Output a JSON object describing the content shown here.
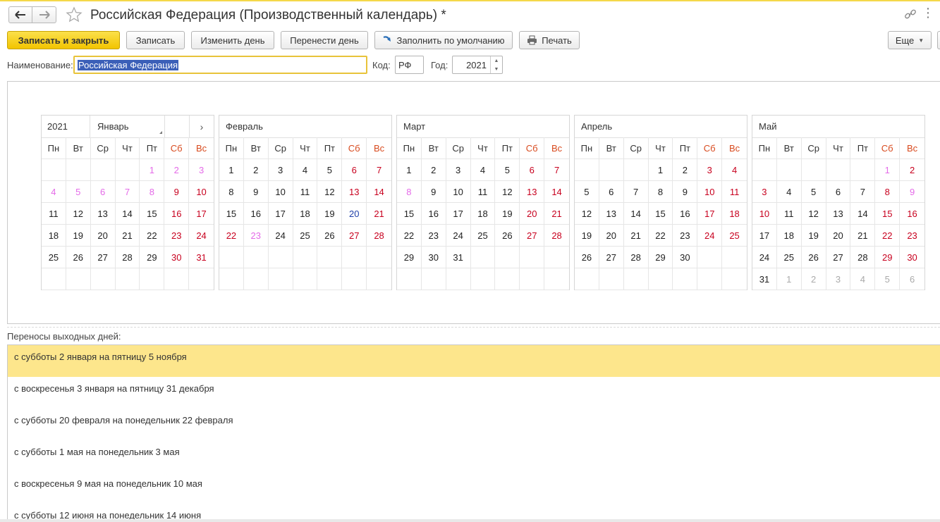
{
  "window": {
    "title": "Российская Федерация (Производственный календарь) *"
  },
  "toolbar": {
    "save_close": "Записать и закрыть",
    "save": "Записать",
    "change_day": "Изменить день",
    "move_day": "Перенести день",
    "fill_default": "Заполнить по умолчанию",
    "print": "Печать",
    "more": "Еще"
  },
  "form": {
    "name_label": "Наименование:",
    "name_value": "Российская Федерация",
    "code_label": "Код:",
    "code_value": "РФ",
    "year_label": "Год:",
    "year_value": "2021"
  },
  "calendar": {
    "year": "2021",
    "weekdays": [
      "Пн",
      "Вт",
      "Ср",
      "Чт",
      "Пт",
      "Сб",
      "Вс"
    ],
    "legend_colors": {
      "workday": "#222222",
      "holiday": "#c8001e",
      "pre_holiday": "#e46ae8",
      "transferred_workday": "#1f3fa8",
      "other_month": "#aaaaaa"
    },
    "months": [
      {
        "name": "Январь",
        "cells": [
          {
            "d": "",
            "t": "w"
          },
          {
            "d": "",
            "t": "w"
          },
          {
            "d": "",
            "t": "w"
          },
          {
            "d": "",
            "t": "w"
          },
          {
            "d": "1",
            "t": "p"
          },
          {
            "d": "2",
            "t": "p"
          },
          {
            "d": "3",
            "t": "p"
          },
          {
            "d": "4",
            "t": "p"
          },
          {
            "d": "5",
            "t": "p"
          },
          {
            "d": "6",
            "t": "p"
          },
          {
            "d": "7",
            "t": "p"
          },
          {
            "d": "8",
            "t": "p"
          },
          {
            "d": "9",
            "t": "h"
          },
          {
            "d": "10",
            "t": "h"
          },
          {
            "d": "11",
            "t": "w"
          },
          {
            "d": "12",
            "t": "w"
          },
          {
            "d": "13",
            "t": "w"
          },
          {
            "d": "14",
            "t": "w"
          },
          {
            "d": "15",
            "t": "w"
          },
          {
            "d": "16",
            "t": "h"
          },
          {
            "d": "17",
            "t": "h"
          },
          {
            "d": "18",
            "t": "w"
          },
          {
            "d": "19",
            "t": "w"
          },
          {
            "d": "20",
            "t": "w"
          },
          {
            "d": "21",
            "t": "w"
          },
          {
            "d": "22",
            "t": "w"
          },
          {
            "d": "23",
            "t": "h"
          },
          {
            "d": "24",
            "t": "h"
          },
          {
            "d": "25",
            "t": "w"
          },
          {
            "d": "26",
            "t": "w"
          },
          {
            "d": "27",
            "t": "w"
          },
          {
            "d": "28",
            "t": "w"
          },
          {
            "d": "29",
            "t": "w"
          },
          {
            "d": "30",
            "t": "h"
          },
          {
            "d": "31",
            "t": "h"
          },
          {
            "d": "",
            "t": "w"
          },
          {
            "d": "",
            "t": "w"
          },
          {
            "d": "",
            "t": "w"
          },
          {
            "d": "",
            "t": "w"
          },
          {
            "d": "",
            "t": "w"
          },
          {
            "d": "",
            "t": "w"
          },
          {
            "d": "",
            "t": "w"
          }
        ]
      },
      {
        "name": "Февраль",
        "cells": [
          {
            "d": "1",
            "t": "w"
          },
          {
            "d": "2",
            "t": "w"
          },
          {
            "d": "3",
            "t": "w"
          },
          {
            "d": "4",
            "t": "w"
          },
          {
            "d": "5",
            "t": "w"
          },
          {
            "d": "6",
            "t": "h"
          },
          {
            "d": "7",
            "t": "h"
          },
          {
            "d": "8",
            "t": "w"
          },
          {
            "d": "9",
            "t": "w"
          },
          {
            "d": "10",
            "t": "w"
          },
          {
            "d": "11",
            "t": "w"
          },
          {
            "d": "12",
            "t": "w"
          },
          {
            "d": "13",
            "t": "h"
          },
          {
            "d": "14",
            "t": "h"
          },
          {
            "d": "15",
            "t": "w"
          },
          {
            "d": "16",
            "t": "w"
          },
          {
            "d": "17",
            "t": "w"
          },
          {
            "d": "18",
            "t": "w"
          },
          {
            "d": "19",
            "t": "w"
          },
          {
            "d": "20",
            "t": "b"
          },
          {
            "d": "21",
            "t": "h"
          },
          {
            "d": "22",
            "t": "h"
          },
          {
            "d": "23",
            "t": "p"
          },
          {
            "d": "24",
            "t": "w"
          },
          {
            "d": "25",
            "t": "w"
          },
          {
            "d": "26",
            "t": "w"
          },
          {
            "d": "27",
            "t": "h"
          },
          {
            "d": "28",
            "t": "h"
          },
          {
            "d": "",
            "t": "w"
          },
          {
            "d": "",
            "t": "w"
          },
          {
            "d": "",
            "t": "w"
          },
          {
            "d": "",
            "t": "w"
          },
          {
            "d": "",
            "t": "w"
          },
          {
            "d": "",
            "t": "w"
          },
          {
            "d": "",
            "t": "w"
          },
          {
            "d": "",
            "t": "w"
          },
          {
            "d": "",
            "t": "w"
          },
          {
            "d": "",
            "t": "w"
          },
          {
            "d": "",
            "t": "w"
          },
          {
            "d": "",
            "t": "w"
          },
          {
            "d": "",
            "t": "w"
          },
          {
            "d": "",
            "t": "w"
          }
        ]
      },
      {
        "name": "Март",
        "cells": [
          {
            "d": "1",
            "t": "w"
          },
          {
            "d": "2",
            "t": "w"
          },
          {
            "d": "3",
            "t": "w"
          },
          {
            "d": "4",
            "t": "w"
          },
          {
            "d": "5",
            "t": "w"
          },
          {
            "d": "6",
            "t": "h"
          },
          {
            "d": "7",
            "t": "h"
          },
          {
            "d": "8",
            "t": "p"
          },
          {
            "d": "9",
            "t": "w"
          },
          {
            "d": "10",
            "t": "w"
          },
          {
            "d": "11",
            "t": "w"
          },
          {
            "d": "12",
            "t": "w"
          },
          {
            "d": "13",
            "t": "h"
          },
          {
            "d": "14",
            "t": "h"
          },
          {
            "d": "15",
            "t": "w"
          },
          {
            "d": "16",
            "t": "w"
          },
          {
            "d": "17",
            "t": "w"
          },
          {
            "d": "18",
            "t": "w"
          },
          {
            "d": "19",
            "t": "w"
          },
          {
            "d": "20",
            "t": "h"
          },
          {
            "d": "21",
            "t": "h"
          },
          {
            "d": "22",
            "t": "w"
          },
          {
            "d": "23",
            "t": "w"
          },
          {
            "d": "24",
            "t": "w"
          },
          {
            "d": "25",
            "t": "w"
          },
          {
            "d": "26",
            "t": "w"
          },
          {
            "d": "27",
            "t": "h"
          },
          {
            "d": "28",
            "t": "h"
          },
          {
            "d": "29",
            "t": "w"
          },
          {
            "d": "30",
            "t": "w"
          },
          {
            "d": "31",
            "t": "w"
          },
          {
            "d": "",
            "t": "w"
          },
          {
            "d": "",
            "t": "w"
          },
          {
            "d": "",
            "t": "w"
          },
          {
            "d": "",
            "t": "w"
          },
          {
            "d": "",
            "t": "w"
          },
          {
            "d": "",
            "t": "w"
          },
          {
            "d": "",
            "t": "w"
          },
          {
            "d": "",
            "t": "w"
          },
          {
            "d": "",
            "t": "w"
          },
          {
            "d": "",
            "t": "w"
          },
          {
            "d": "",
            "t": "w"
          }
        ]
      },
      {
        "name": "Апрель",
        "cells": [
          {
            "d": "",
            "t": "w"
          },
          {
            "d": "",
            "t": "w"
          },
          {
            "d": "",
            "t": "w"
          },
          {
            "d": "1",
            "t": "w"
          },
          {
            "d": "2",
            "t": "w"
          },
          {
            "d": "3",
            "t": "h"
          },
          {
            "d": "4",
            "t": "h"
          },
          {
            "d": "5",
            "t": "w"
          },
          {
            "d": "6",
            "t": "w"
          },
          {
            "d": "7",
            "t": "w"
          },
          {
            "d": "8",
            "t": "w"
          },
          {
            "d": "9",
            "t": "w"
          },
          {
            "d": "10",
            "t": "h"
          },
          {
            "d": "11",
            "t": "h"
          },
          {
            "d": "12",
            "t": "w"
          },
          {
            "d": "13",
            "t": "w"
          },
          {
            "d": "14",
            "t": "w"
          },
          {
            "d": "15",
            "t": "w"
          },
          {
            "d": "16",
            "t": "w"
          },
          {
            "d": "17",
            "t": "h"
          },
          {
            "d": "18",
            "t": "h"
          },
          {
            "d": "19",
            "t": "w"
          },
          {
            "d": "20",
            "t": "w"
          },
          {
            "d": "21",
            "t": "w"
          },
          {
            "d": "22",
            "t": "w"
          },
          {
            "d": "23",
            "t": "w"
          },
          {
            "d": "24",
            "t": "h"
          },
          {
            "d": "25",
            "t": "h"
          },
          {
            "d": "26",
            "t": "w"
          },
          {
            "d": "27",
            "t": "w"
          },
          {
            "d": "28",
            "t": "w"
          },
          {
            "d": "29",
            "t": "w"
          },
          {
            "d": "30",
            "t": "w"
          },
          {
            "d": "",
            "t": "w"
          },
          {
            "d": "",
            "t": "w"
          },
          {
            "d": "",
            "t": "w"
          },
          {
            "d": "",
            "t": "w"
          },
          {
            "d": "",
            "t": "w"
          },
          {
            "d": "",
            "t": "w"
          },
          {
            "d": "",
            "t": "w"
          },
          {
            "d": "",
            "t": "w"
          },
          {
            "d": "",
            "t": "w"
          }
        ]
      },
      {
        "name": "Май",
        "cells": [
          {
            "d": "",
            "t": "w"
          },
          {
            "d": "",
            "t": "w"
          },
          {
            "d": "",
            "t": "w"
          },
          {
            "d": "",
            "t": "w"
          },
          {
            "d": "",
            "t": "w"
          },
          {
            "d": "1",
            "t": "p"
          },
          {
            "d": "2",
            "t": "h"
          },
          {
            "d": "3",
            "t": "h"
          },
          {
            "d": "4",
            "t": "w"
          },
          {
            "d": "5",
            "t": "w"
          },
          {
            "d": "6",
            "t": "w"
          },
          {
            "d": "7",
            "t": "w"
          },
          {
            "d": "8",
            "t": "h"
          },
          {
            "d": "9",
            "t": "p"
          },
          {
            "d": "10",
            "t": "h"
          },
          {
            "d": "11",
            "t": "w"
          },
          {
            "d": "12",
            "t": "w"
          },
          {
            "d": "13",
            "t": "w"
          },
          {
            "d": "14",
            "t": "w"
          },
          {
            "d": "15",
            "t": "h"
          },
          {
            "d": "16",
            "t": "h"
          },
          {
            "d": "17",
            "t": "w"
          },
          {
            "d": "18",
            "t": "w"
          },
          {
            "d": "19",
            "t": "w"
          },
          {
            "d": "20",
            "t": "w"
          },
          {
            "d": "21",
            "t": "w"
          },
          {
            "d": "22",
            "t": "h"
          },
          {
            "d": "23",
            "t": "h"
          },
          {
            "d": "24",
            "t": "w"
          },
          {
            "d": "25",
            "t": "w"
          },
          {
            "d": "26",
            "t": "w"
          },
          {
            "d": "27",
            "t": "w"
          },
          {
            "d": "28",
            "t": "w"
          },
          {
            "d": "29",
            "t": "h"
          },
          {
            "d": "30",
            "t": "h"
          },
          {
            "d": "31",
            "t": "w"
          },
          {
            "d": "1",
            "t": "o"
          },
          {
            "d": "2",
            "t": "o"
          },
          {
            "d": "3",
            "t": "o"
          },
          {
            "d": "4",
            "t": "o"
          },
          {
            "d": "5",
            "t": "o"
          },
          {
            "d": "6",
            "t": "o"
          }
        ]
      }
    ]
  },
  "transfers": {
    "label": "Переносы выходных дней:",
    "items": [
      "с субботы 2 января на пятницу 5 ноября",
      "с воскресенья 3 января на пятницу 31 декабря",
      "с субботы 20 февраля на понедельник 22 февраля",
      "с субботы 1 мая на понедельник 3 мая",
      "с воскресенья 9 мая на понедельник 10 мая",
      "с субботы 12 июня на понедельник 14 июня"
    ]
  }
}
